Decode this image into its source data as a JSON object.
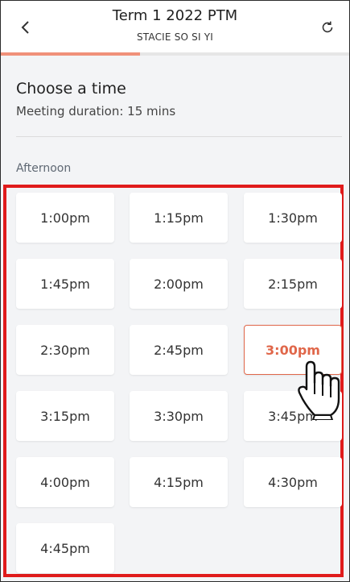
{
  "header": {
    "title": "Term 1 2022 PTM",
    "subtitle": "STACIE SO SI YI",
    "back_icon": "chevron-left-icon",
    "refresh_icon": "refresh-icon",
    "progress_fraction": 0.4
  },
  "info": {
    "title": "Choose a time",
    "duration": "Meeting duration: 15 mins"
  },
  "section": {
    "label": "Afternoon"
  },
  "slots": [
    {
      "label": "1:00pm"
    },
    {
      "label": "1:15pm"
    },
    {
      "label": "1:30pm"
    },
    {
      "label": "1:45pm"
    },
    {
      "label": "2:00pm"
    },
    {
      "label": "2:15pm"
    },
    {
      "label": "2:30pm"
    },
    {
      "label": "2:45pm"
    },
    {
      "label": "3:00pm",
      "selected": true
    },
    {
      "label": "3:15pm"
    },
    {
      "label": "3:30pm"
    },
    {
      "label": "3:45pm"
    },
    {
      "label": "4:00pm"
    },
    {
      "label": "4:15pm"
    },
    {
      "label": "4:30pm"
    },
    {
      "label": "4:45pm"
    }
  ],
  "colors": {
    "accent": "#e0674a",
    "progress": "#f0917a",
    "highlight_border": "#e01b1b"
  }
}
